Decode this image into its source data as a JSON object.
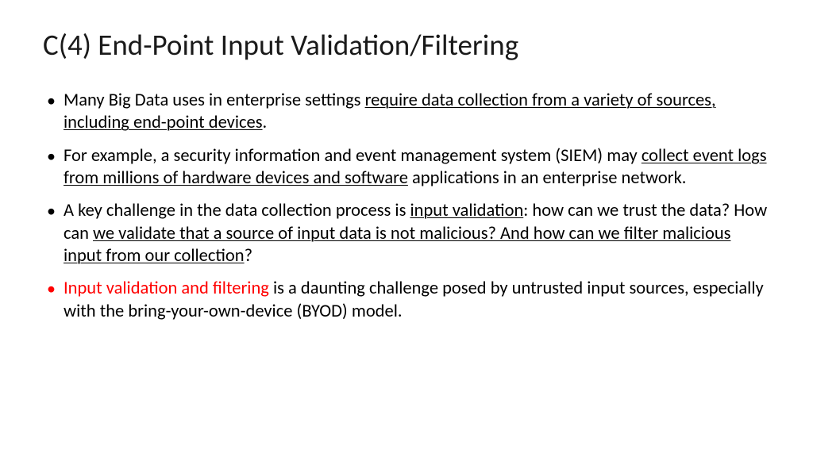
{
  "title": "C(4) End-Point Input Validation/Filtering",
  "bullets": [
    {
      "segments": [
        {
          "text": "Many Big Data uses in enterprise settings "
        },
        {
          "text": "require data collection from a variety of sources, including end-point devices",
          "underline": true
        },
        {
          "text": "."
        }
      ]
    },
    {
      "segments": [
        {
          "text": "For example, a security information and event management system (SIEM) may "
        },
        {
          "text": "collect event logs from millions of hardware devices and software",
          "underline": true
        },
        {
          "text": " applications in an enterprise network."
        }
      ]
    },
    {
      "segments": [
        {
          "text": "A key challenge in the data collection process is "
        },
        {
          "text": "input validation",
          "underline": true
        },
        {
          "text": ": how can we trust the data? How can "
        },
        {
          "text": "we validate that a source of input data is not malicious? And how can we filter malicious input from our collection",
          "underline": true
        },
        {
          "text": "?"
        }
      ]
    },
    {
      "redBullet": true,
      "segments": [
        {
          "text": "Input validation and filtering",
          "red": true
        },
        {
          "text": " is a daunting challenge posed by untrusted input sources, especially with the bring-your-own-device (BYOD) model."
        }
      ]
    }
  ]
}
